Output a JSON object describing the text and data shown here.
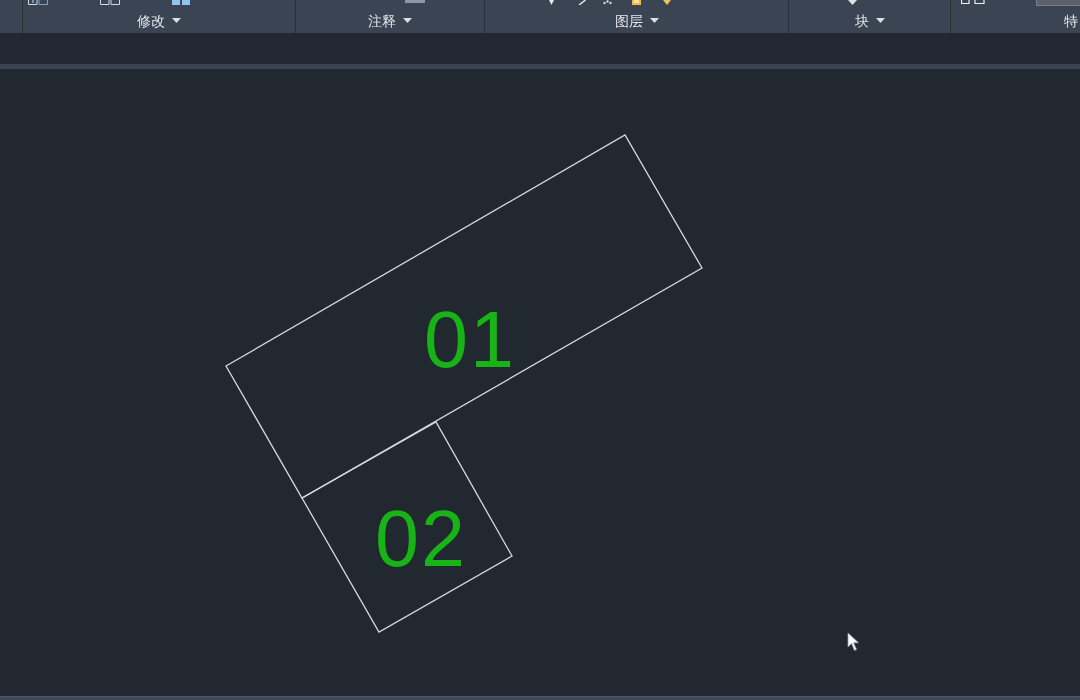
{
  "ribbon": {
    "panels": [
      {
        "label": "修改",
        "menu": true
      },
      {
        "label": "注释",
        "menu": true
      },
      {
        "label": "图层",
        "menu": true
      },
      {
        "label": "块",
        "menu": true
      },
      {
        "label": "特",
        "menu": false
      }
    ]
  },
  "drawing": {
    "shapes": [
      {
        "label": "01"
      },
      {
        "label": "02"
      }
    ]
  }
}
